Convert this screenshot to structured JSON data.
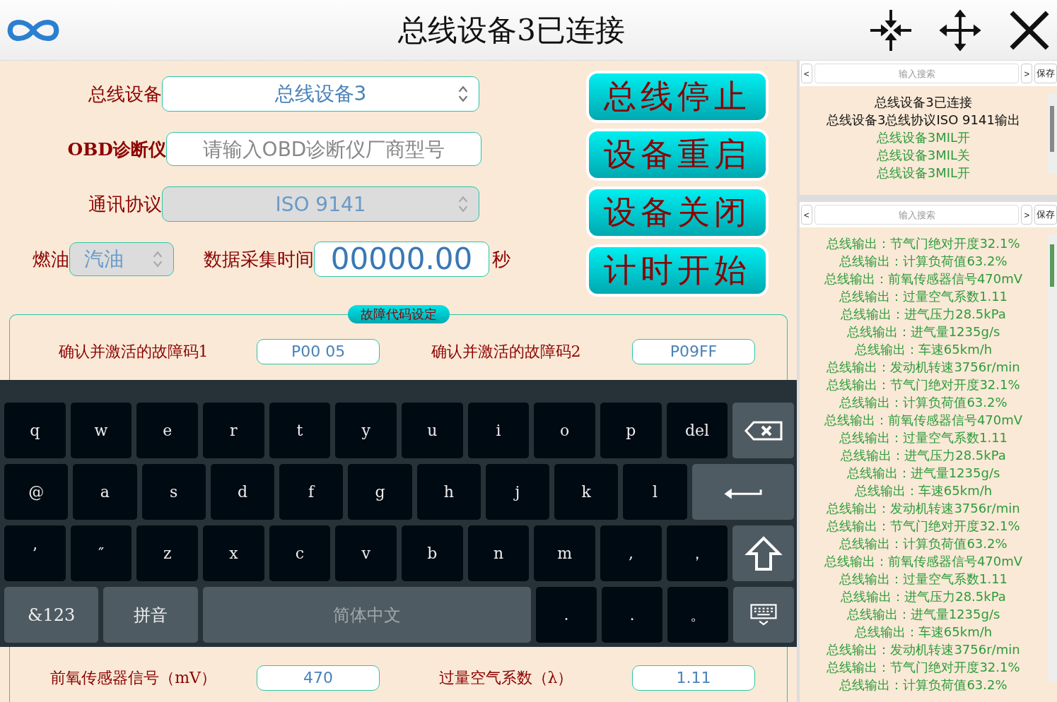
{
  "window": {
    "title": "总线设备3已连接"
  },
  "form": {
    "bus_device": {
      "label": "总线设备",
      "value": "总线设备3"
    },
    "obd": {
      "label": "OBD诊断仪",
      "placeholder": "请输入OBD诊断仪厂商型号"
    },
    "protocol": {
      "label": "通讯协议",
      "value": "ISO 9141",
      "disabled": true
    },
    "fuel": {
      "label": "燃油",
      "value": "汽油",
      "disabled": true
    },
    "collect_time": {
      "label": "数据采集时间",
      "value": "00000.00",
      "unit": "秒"
    }
  },
  "buttons": [
    "总线停止",
    "设备重启",
    "设备关闭",
    "计时开始"
  ],
  "fault_section": {
    "title": "故障代码设定",
    "top_rows": [
      {
        "label": "确认并激活的故障码1",
        "value": "P00 05"
      },
      {
        "label": "确认并激活的故障码2",
        "value": "P09FF"
      }
    ],
    "bottom_rows": [
      {
        "label": "前氧传感器信号（mV）",
        "value": "470"
      },
      {
        "label": "过量空气系数（λ）",
        "value": "1.11"
      }
    ]
  },
  "keyboard": {
    "rows": [
      [
        {
          "kind": "char",
          "label": "q"
        },
        {
          "kind": "char",
          "label": "w"
        },
        {
          "kind": "char",
          "label": "e"
        },
        {
          "kind": "char",
          "label": "r"
        },
        {
          "kind": "char",
          "label": "t"
        },
        {
          "kind": "char",
          "label": "y"
        },
        {
          "kind": "char",
          "label": "u"
        },
        {
          "kind": "char",
          "label": "i"
        },
        {
          "kind": "char",
          "label": "o"
        },
        {
          "kind": "char",
          "label": "p"
        },
        {
          "kind": "char",
          "label": "del"
        },
        {
          "kind": "backspace"
        }
      ],
      [
        {
          "kind": "char",
          "label": "@"
        },
        {
          "kind": "char",
          "label": "a"
        },
        {
          "kind": "char",
          "label": "s"
        },
        {
          "kind": "char",
          "label": "d"
        },
        {
          "kind": "char",
          "label": "f"
        },
        {
          "kind": "char",
          "label": "g"
        },
        {
          "kind": "char",
          "label": "h"
        },
        {
          "kind": "char",
          "label": "j"
        },
        {
          "kind": "char",
          "label": "k"
        },
        {
          "kind": "char",
          "label": "l"
        },
        {
          "kind": "enter"
        }
      ],
      [
        {
          "kind": "char",
          "label": "’"
        },
        {
          "kind": "char",
          "label": "″"
        },
        {
          "kind": "char",
          "label": "z"
        },
        {
          "kind": "char",
          "label": "x"
        },
        {
          "kind": "char",
          "label": "c"
        },
        {
          "kind": "char",
          "label": "v"
        },
        {
          "kind": "char",
          "label": "b"
        },
        {
          "kind": "char",
          "label": "n"
        },
        {
          "kind": "char",
          "label": "m"
        },
        {
          "kind": "char",
          "label": ","
        },
        {
          "kind": "char",
          "label": "，"
        },
        {
          "kind": "shift"
        }
      ]
    ],
    "bottom_bar": [
      {
        "kind": "function",
        "label": "&123"
      },
      {
        "kind": "function",
        "label": "拼音"
      },
      {
        "kind": "space",
        "label": "简体中文"
      },
      {
        "kind": "char",
        "label": "."
      },
      {
        "kind": "char",
        "label": "．"
      },
      {
        "kind": "char",
        "label": "。"
      },
      {
        "kind": "hide"
      }
    ]
  },
  "log_panels": [
    {
      "prev": "<",
      "search": {
        "placeholder": "输入搜索"
      },
      "next": ">",
      "save": "保存",
      "lines": [
        {
          "text": "总线设备3已连接",
          "kind": "status"
        },
        {
          "text": "总线设备3总线协议ISO 9141输出",
          "kind": "status"
        },
        {
          "text": "总线设备3MIL开",
          "kind": "output"
        },
        {
          "text": "总线设备3MIL关",
          "kind": "output"
        },
        {
          "text": "总线设备3MIL开",
          "kind": "output"
        }
      ]
    },
    {
      "prev": "<",
      "search": {
        "placeholder": "输入搜索"
      },
      "next": ">",
      "save": "保存",
      "lines": [
        {
          "text": "总线输出：节气门绝对开度32.1%",
          "kind": "output"
        },
        {
          "text": "总线输出：计算负荷值63.2%",
          "kind": "output"
        },
        {
          "text": "总线输出：前氧传感器信号470mV",
          "kind": "output"
        },
        {
          "text": "总线输出：过量空气系数1.11",
          "kind": "output"
        },
        {
          "text": "总线输出：进气压力28.5kPa",
          "kind": "output"
        },
        {
          "text": "总线输出：进气量1235g/s",
          "kind": "output"
        },
        {
          "text": "总线输出：车速65km/h",
          "kind": "output"
        },
        {
          "text": "总线输出：发动机转速3756r/min",
          "kind": "output"
        },
        {
          "text": "总线输出：节气门绝对开度32.1%",
          "kind": "output"
        },
        {
          "text": "总线输出：计算负荷值63.2%",
          "kind": "output"
        },
        {
          "text": "总线输出：前氧传感器信号470mV",
          "kind": "output"
        },
        {
          "text": "总线输出：过量空气系数1.11",
          "kind": "output"
        },
        {
          "text": "总线输出：进气压力28.5kPa",
          "kind": "output"
        },
        {
          "text": "总线输出：进气量1235g/s",
          "kind": "output"
        },
        {
          "text": "总线输出：车速65km/h",
          "kind": "output"
        },
        {
          "text": "总线输出：发动机转速3756r/min",
          "kind": "output"
        },
        {
          "text": "总线输出：节气门绝对开度32.1%",
          "kind": "output"
        },
        {
          "text": "总线输出：计算负荷值63.2%",
          "kind": "output"
        },
        {
          "text": "总线输出：前氧传感器信号470mV",
          "kind": "output"
        },
        {
          "text": "总线输出：过量空气系数1.11",
          "kind": "output"
        },
        {
          "text": "总线输出：进气压力28.5kPa",
          "kind": "output"
        },
        {
          "text": "总线输出：进气量1235g/s",
          "kind": "output"
        },
        {
          "text": "总线输出：车速65km/h",
          "kind": "output"
        },
        {
          "text": "总线输出：发动机转速3756r/min",
          "kind": "output"
        },
        {
          "text": "总线输出：节气门绝对开度32.1%",
          "kind": "output"
        },
        {
          "text": "总线输出：计算负荷值63.2%",
          "kind": "output"
        }
      ]
    }
  ]
}
